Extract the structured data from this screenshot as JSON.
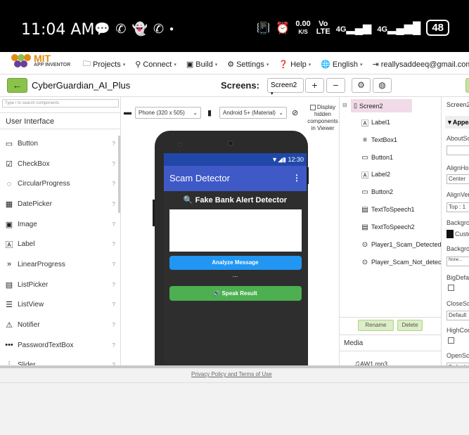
{
  "status_bar": {
    "time": "11:04 AM",
    "speed_value": "0.00",
    "speed_unit": "K/S",
    "net1_a": "Vo",
    "net1_b": "LTE",
    "net2": "4G",
    "net3": "4G",
    "battery": "48"
  },
  "top_menu": {
    "logo_text": "MIT",
    "logo_sub": "APP INVENTOR",
    "items": [
      "Projects",
      "Connect",
      "Build",
      "Settings",
      "Help",
      "English",
      "reallysaddeeq@gmail.com"
    ]
  },
  "project_bar": {
    "project_name": "CyberGuardian_AI_Plus",
    "screens_label": "Screens:",
    "current_screen": "Screen2",
    "add_label": "+",
    "remove_label": "−"
  },
  "palette": {
    "search_placeholder": "Type / to search components",
    "category": "User Interface",
    "items": [
      "Button",
      "CheckBox",
      "CircularProgress",
      "DatePicker",
      "Image",
      "Label",
      "LinearProgress",
      "ListPicker",
      "ListView",
      "Notifier",
      "PasswordTextBox",
      "Slider"
    ]
  },
  "viewer": {
    "device_select": "Phone (320 x 505)",
    "theme_select": "Android 5+ (Material)",
    "hidden_line1": "Display",
    "hidden_line2": "hidden",
    "hidden_line3": "components",
    "hidden_line4": "in Viewer",
    "phone": {
      "clock": "12:30",
      "app_title": "Scam Detector",
      "menu_dots": "⋮",
      "heading": "🔍 Fake Bank Alert Detector",
      "analyze_button": "Analyze Message",
      "label2_text": "...",
      "speak_button": "🔊 Speak Result"
    }
  },
  "components": {
    "screen": "Screen2",
    "items": [
      "Label1",
      "TextBox1",
      "Button1",
      "Label2",
      "Button2",
      "TextToSpeech1",
      "TextToSpeech2",
      "Player1_Scam_Detected",
      "Player_Scam_Not_detected"
    ],
    "rename_label": "Rename",
    "delete_label": "Delete",
    "media_header": "Media",
    "media_items": [
      "AW1.mp3"
    ]
  },
  "properties": {
    "header": "Screen2",
    "section": "Appearance",
    "labels": [
      "AboutScreen",
      "AlignHorizontal",
      "AlignVertical",
      "BackgroundColor",
      "BackgroundImage",
      "BigDefaultText",
      "CloseScreenAnimation",
      "HighContrast",
      "OpenScreenAnimation"
    ],
    "align_h_value": "Center",
    "align_v_value": "Top : 1",
    "bg_color_value": "Custom",
    "bg_image_value": "None...",
    "close_anim_value": "Default",
    "open_anim_value": "Default"
  },
  "footer": {
    "link": "Privacy Policy and Terms of Use"
  }
}
